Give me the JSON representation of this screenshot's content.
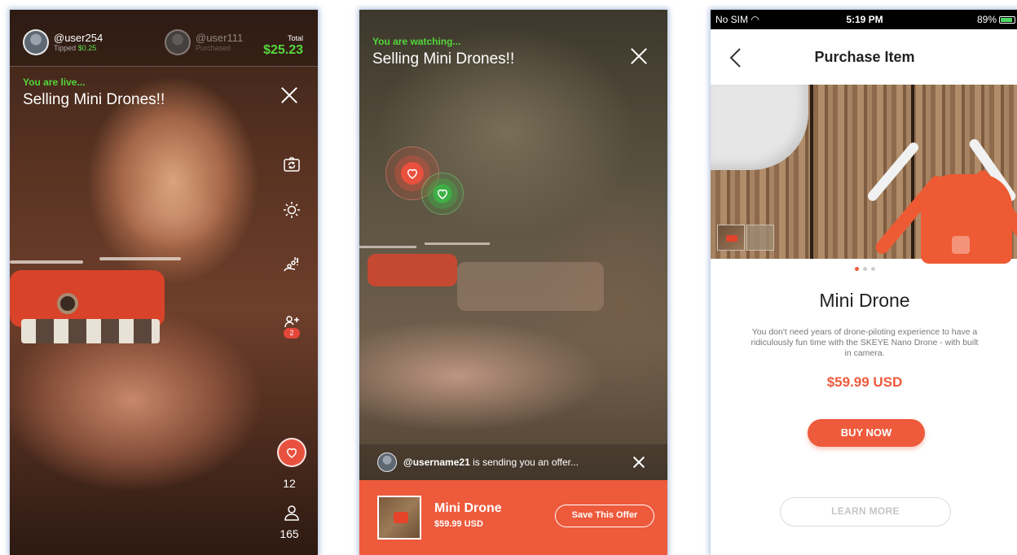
{
  "screen1": {
    "host": {
      "name": "@user254",
      "sub_prefix": "Tipped ",
      "sub_value": "$0.25"
    },
    "other": {
      "name": "@user111",
      "sub": "Purchased"
    },
    "total": {
      "label": "Total",
      "value": "$25.23"
    },
    "status": "You are live...",
    "title": "Selling Mini Drones!!",
    "badge": "2",
    "likes": "12",
    "viewers": "165",
    "icons": [
      "camera-flip-icon",
      "brightness-icon",
      "people-alert-icon",
      "add-user-icon",
      "heart-icon",
      "viewer-icon",
      "close-icon"
    ]
  },
  "screen2": {
    "status": "You are watching...",
    "title": "Selling Mini Drones!!",
    "offer_user": "@username21",
    "offer_text": " is sending you an offer...",
    "product": {
      "name": "Mini Drone",
      "price": "$59.99 USD"
    },
    "save_label": "Save This Offer",
    "accent": "#ee5a3c"
  },
  "screen3": {
    "status_bar": {
      "carrier": "No SIM",
      "time": "5:19 PM",
      "battery": "89%"
    },
    "nav_title": "Purchase Item",
    "product": {
      "name": "Mini Drone",
      "description": "You don't need years of drone-piloting experience to have a ridiculously fun time with the SKEYE Nano Drone - with built in camera.",
      "price": "$59.99 USD"
    },
    "buy_label": "BUY NOW",
    "learn_label": "LEARN MORE",
    "accent": "#ee5a3c"
  }
}
